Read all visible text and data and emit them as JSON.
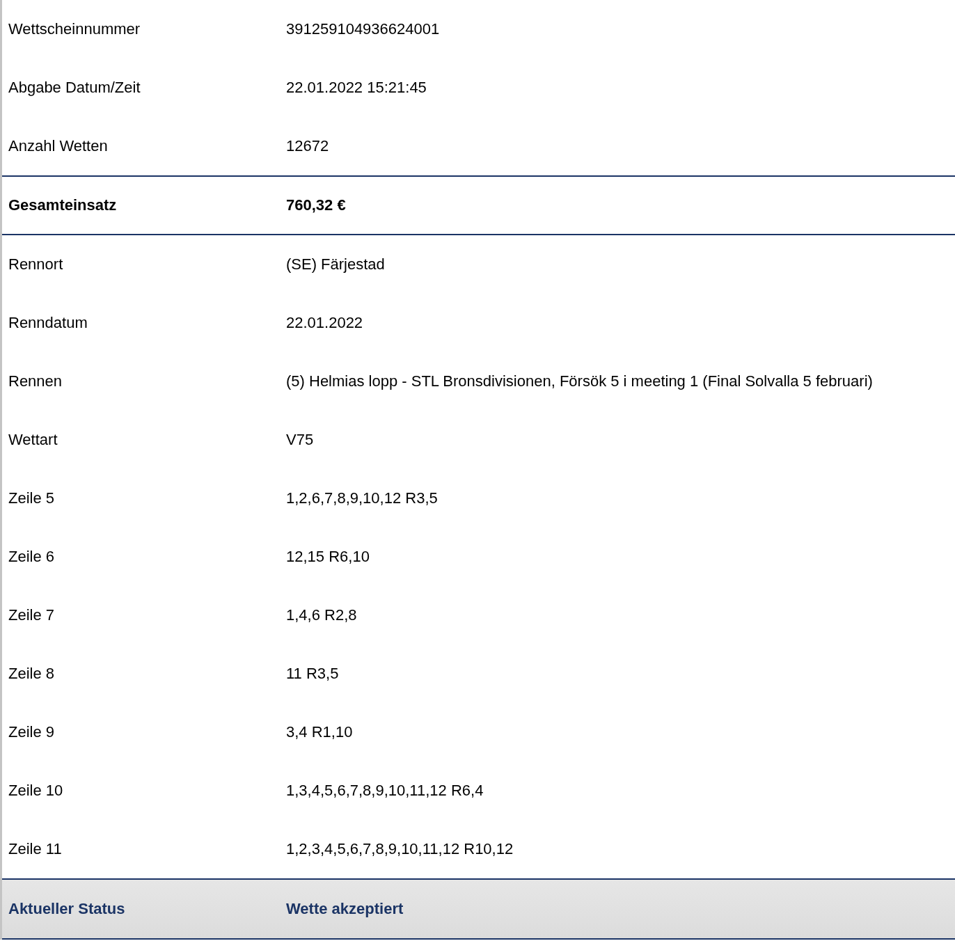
{
  "rows": [
    {
      "kind": "plain",
      "label": "Wettscheinnummer",
      "value": "391259104936624001"
    },
    {
      "kind": "plain",
      "label": "Abgabe Datum/Zeit",
      "value": "22.01.2022 15:21:45"
    },
    {
      "kind": "plain",
      "label": "Anzahl Wetten",
      "value": "12672"
    },
    {
      "kind": "total",
      "label": "Gesamteinsatz",
      "value": "760,32 €"
    },
    {
      "kind": "plain",
      "label": "Rennort",
      "value": "(SE) Färjestad"
    },
    {
      "kind": "plain",
      "label": "Renndatum",
      "value": "22.01.2022"
    },
    {
      "kind": "plain",
      "label": "Rennen",
      "value": "(5) Helmias lopp - STL Bronsdivisionen, Försök 5 i meeting 1 (Final Solvalla 5 februari)"
    },
    {
      "kind": "plain",
      "label": "Wettart",
      "value": "V75"
    },
    {
      "kind": "plain",
      "label": "Zeile 5",
      "value": "1,2,6,7,8,9,10,12 R3,5"
    },
    {
      "kind": "plain",
      "label": "Zeile 6",
      "value": "12,15 R6,10"
    },
    {
      "kind": "plain",
      "label": "Zeile 7",
      "value": "1,4,6 R2,8"
    },
    {
      "kind": "plain",
      "label": "Zeile 8",
      "value": "11 R3,5"
    },
    {
      "kind": "plain",
      "label": "Zeile 9",
      "value": "3,4 R1,10"
    },
    {
      "kind": "plain",
      "label": "Zeile 10",
      "value": "1,3,4,5,6,7,8,9,10,11,12 R6,4"
    },
    {
      "kind": "plain",
      "label": "Zeile 11",
      "value": "1,2,3,4,5,6,7,8,9,10,11,12 R10,12"
    },
    {
      "kind": "status",
      "label": "Aktueller Status",
      "value": "Wette akzeptiert"
    }
  ]
}
